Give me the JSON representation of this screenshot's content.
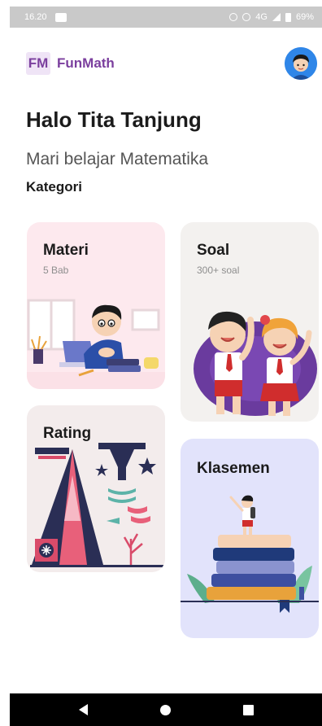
{
  "status_bar": {
    "time": "16.20",
    "network": "4G",
    "battery": "69%",
    "icons": [
      "message-icon",
      "alarm-icon",
      "vibrate-icon",
      "signal-icon",
      "battery-icon"
    ]
  },
  "header": {
    "logo_text": "FM",
    "app_name": "FunMath",
    "avatar_icon": "user-avatar"
  },
  "greeting": "Halo Tita Tanjung",
  "subtitle": "Mari belajar Matematika",
  "section_title": "Kategori",
  "categories": [
    {
      "title": "Materi",
      "subtitle": "5 Bab",
      "color": "#fde9ee",
      "illustration": "student-laptop-illustration"
    },
    {
      "title": "Soal",
      "subtitle": "300+ soal",
      "color": "#f3f1ef",
      "illustration": "kids-cheering-illustration"
    },
    {
      "title": "Rating",
      "subtitle": "",
      "color": "#f3ecec",
      "illustration": "abstract-art-illustration"
    },
    {
      "title": "Klasemen",
      "subtitle": "",
      "color": "#e2e3fb",
      "illustration": "kid-on-books-illustration"
    }
  ],
  "nav_bar": {
    "icons": [
      "back-icon",
      "home-icon",
      "recents-icon"
    ]
  },
  "colors": {
    "brand": "#7b3f9e",
    "avatar_bg": "#2f86e8"
  }
}
